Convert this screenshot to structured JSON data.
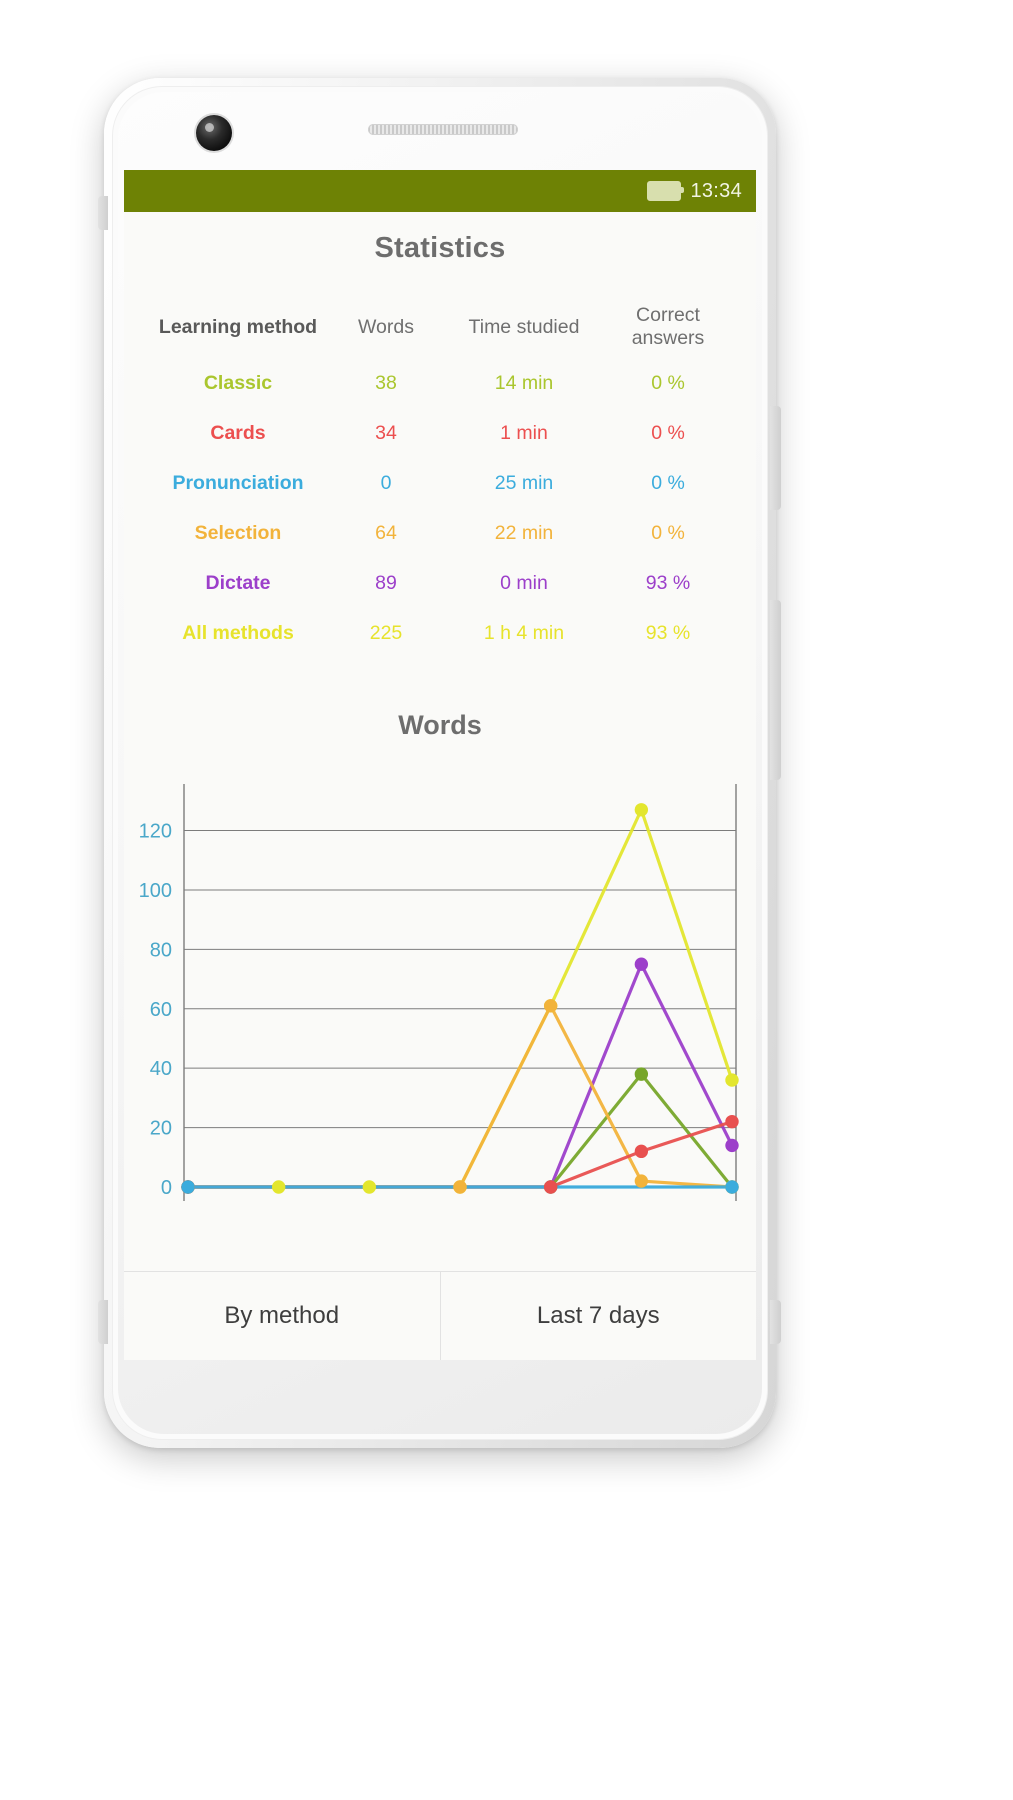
{
  "status_bar": {
    "battery_icon": "battery-full-icon",
    "time": "13:34"
  },
  "header": {
    "title": "Statistics"
  },
  "table": {
    "columns": [
      "Learning method",
      "Words",
      "Time studied",
      "Correct answers"
    ],
    "rows": [
      {
        "method": "Classic",
        "words": "38",
        "time": "14 min",
        "correct": "0 %",
        "color": "#aac62e"
      },
      {
        "method": "Cards",
        "words": "34",
        "time": "1 min",
        "correct": "0 %",
        "color": "#ec4f4f"
      },
      {
        "method": "Pronunciation",
        "words": "0",
        "time": "25 min",
        "correct": "0 %",
        "color": "#3bacdd"
      },
      {
        "method": "Selection",
        "words": "64",
        "time": "22 min",
        "correct": "0 %",
        "color": "#f2b33b"
      },
      {
        "method": "Dictate",
        "words": "89",
        "time": "0 min",
        "correct": "93 %",
        "color": "#9c3fca"
      },
      {
        "method": "All methods",
        "words": "225",
        "time": "1 h 4 min",
        "correct": "93 %",
        "color": "#e7e32c"
      }
    ]
  },
  "chart_data": {
    "type": "line",
    "title": "Words",
    "xlabel": "",
    "ylabel": "",
    "ylim": [
      0,
      135
    ],
    "yticks": [
      0,
      20,
      40,
      60,
      80,
      100,
      120
    ],
    "ytick_labels": [
      "0",
      "20",
      "40",
      "60",
      "80",
      "100",
      "120"
    ],
    "grid": true,
    "legend": "none",
    "x": [
      1,
      2,
      3,
      4,
      5,
      6,
      7
    ],
    "series": [
      {
        "name": "All methods",
        "color": "#e3e62e",
        "values": [
          0,
          0,
          0,
          0,
          61,
          127,
          36
        ]
      },
      {
        "name": "Dictate",
        "color": "#9c3fca",
        "values": [
          0,
          0,
          0,
          0,
          0,
          75,
          14
        ]
      },
      {
        "name": "Classic",
        "color": "#77a62a",
        "values": [
          0,
          0,
          0,
          0,
          0,
          38,
          0
        ]
      },
      {
        "name": "Selection",
        "color": "#f2b33b",
        "values": [
          0,
          0,
          0,
          0,
          61,
          2,
          0
        ]
      },
      {
        "name": "Cards",
        "color": "#e8504f",
        "values": [
          0,
          0,
          0,
          0,
          0,
          12,
          22
        ]
      },
      {
        "name": "Pronunciation",
        "color": "#3bacdd",
        "values": [
          0,
          0,
          0,
          0,
          0,
          0,
          0
        ]
      }
    ],
    "axis_label_color": "#4aa7c9",
    "grid_color": "#7c7c7c"
  },
  "tabs": [
    {
      "label": "By method",
      "selected": false
    },
    {
      "label": "Last 7 days",
      "selected": true
    }
  ]
}
